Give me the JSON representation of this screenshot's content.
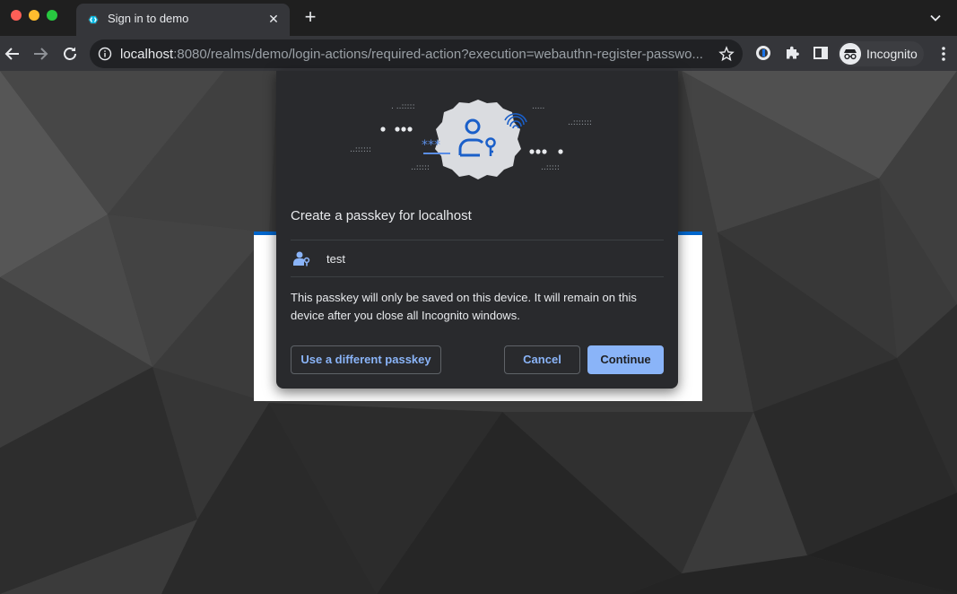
{
  "browser": {
    "tab": {
      "title": "Sign in to demo",
      "close": "✕"
    },
    "new_tab": "+",
    "url_host": "localhost",
    "url_rest": ":8080/realms/demo/login-actions/required-action?execution=webauthn-register-passwo...",
    "profile_label": "Incognito"
  },
  "dialog": {
    "title": "Create a passkey for localhost",
    "account": "test",
    "body": "This passkey will only be saved on this device. It will remain on this device after you close all Incognito windows.",
    "buttons": {
      "different": "Use a different passkey",
      "cancel": "Cancel",
      "continue": "Continue"
    }
  },
  "colors": {
    "accent": "#8ab4f8",
    "login_bar": "#0066cc",
    "illustration_blue": "#1a5fc9"
  }
}
